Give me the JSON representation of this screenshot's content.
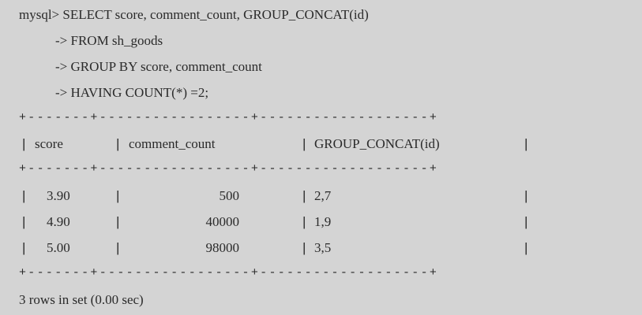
{
  "console": {
    "prompt_line": "mysql> SELECT score, comment_count, GROUP_CONCAT(id)",
    "continuation_lines": [
      "-> FROM sh_goods",
      "-> GROUP BY score, comment_count",
      "-> HAVING COUNT(*) =2;"
    ]
  },
  "result_table": {
    "border_line": "+-------+-----------------+-------------------+",
    "headers": [
      "score",
      "comment_count",
      "GROUP_CONCAT(id)"
    ],
    "rows": [
      [
        "3.90",
        "500",
        "2,7"
      ],
      [
        "4.90",
        "40000",
        "1,9"
      ],
      [
        "5.00",
        "98000",
        "3,5"
      ]
    ]
  },
  "status": {
    "summary": "3 rows in set (0.00 sec)"
  }
}
